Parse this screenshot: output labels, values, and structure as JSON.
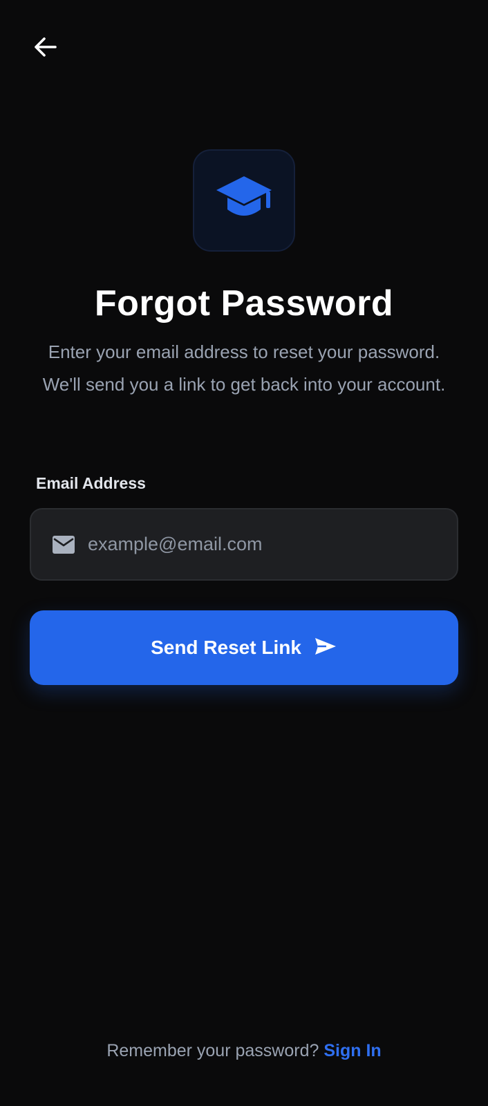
{
  "header": {
    "back_icon": "arrow-left-icon"
  },
  "logo": {
    "icon": "graduation-cap-icon",
    "color": "#2466ea"
  },
  "page": {
    "title": "Forgot Password",
    "subtitle": "Enter your email address to reset your password. We'll send you a link to get back into your account."
  },
  "form": {
    "email_label": "Email Address",
    "email_placeholder": "example@email.com",
    "email_value": "",
    "email_icon": "mail-icon",
    "submit_label": "Send Reset Link",
    "submit_icon": "send-icon"
  },
  "footer": {
    "prompt": "Remember your password?",
    "link_label": "Sign In"
  },
  "colors": {
    "background": "#0a0a0b",
    "accent": "#2466ea",
    "muted_text": "#9aa3b2",
    "field_bg": "#1e1f22"
  }
}
